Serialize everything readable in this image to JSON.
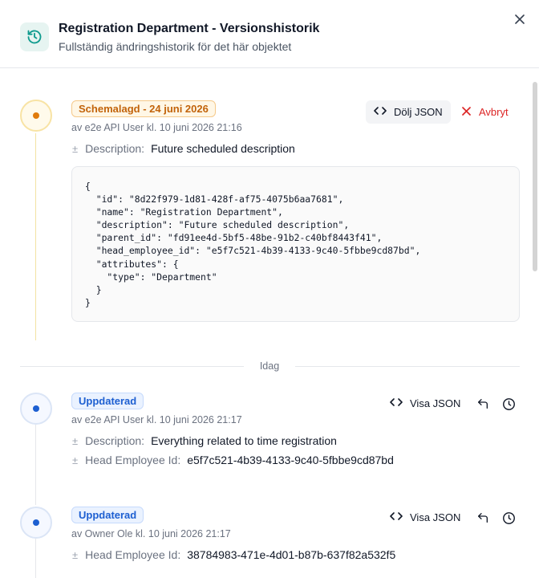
{
  "header": {
    "title": "Registration Department - Versionshistorik",
    "subtitle": "Fullständig ändringshistorik för det här objektet",
    "icon": "history-icon",
    "close_icon": "close-icon"
  },
  "colors": {
    "scheduled_dot": "#e07b0c",
    "updated_dot": "#1d5fd1",
    "scheduled_line": "#f3e3a3",
    "cancel": "#dc2626"
  },
  "entries": [
    {
      "badge": "Schemalagd - 24 juni 2026",
      "meta": "av e2e API User kl. 10 juni 2026 21:16",
      "json_button": "Dölj JSON",
      "cancel_button": "Avbryt",
      "changes": [
        {
          "symbol": "±",
          "field": "Description:",
          "value": "Future scheduled description"
        }
      ],
      "json": "{\n  \"id\": \"8d22f979-1d81-428f-af75-4075b6aa7681\",\n  \"name\": \"Registration Department\",\n  \"description\": \"Future scheduled description\",\n  \"parent_id\": \"fd91ee4d-5bf5-48be-91b2-c40bf8443f41\",\n  \"head_employee_id\": \"e5f7c521-4b39-4133-9c40-5fbbe9cd87bd\",\n  \"attributes\": {\n    \"type\": \"Department\"\n  }\n}"
    },
    {
      "badge": "Uppdaterad",
      "meta": "av e2e API User kl. 10 juni 2026 21:17",
      "json_button": "Visa JSON",
      "changes": [
        {
          "symbol": "±",
          "field": "Description:",
          "value": "Everything related to time registration"
        },
        {
          "symbol": "±",
          "field": "Head Employee Id:",
          "value": "e5f7c521-4b39-4133-9c40-5fbbe9cd87bd"
        }
      ]
    },
    {
      "badge": "Uppdaterad",
      "meta": "av Owner Ole kl. 10 juni 2026 21:17",
      "json_button": "Visa JSON",
      "changes": [
        {
          "symbol": "±",
          "field": "Head Employee Id:",
          "value": "38784983-471e-4d01-b87b-637f82a532f5"
        }
      ]
    }
  ],
  "divider_label": "Idag"
}
